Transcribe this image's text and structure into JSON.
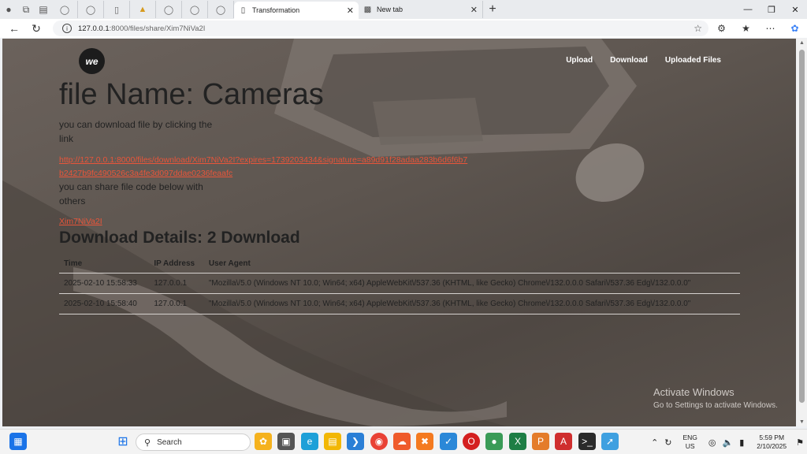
{
  "browser": {
    "tabs": [
      {
        "label": "Transformation",
        "active": true
      },
      {
        "label": "New tab",
        "active": false
      }
    ],
    "url_host": "127.0.0.1",
    "url_path": ":8000/files/share/Xim7NiVa2I"
  },
  "site": {
    "logo_text": "we",
    "nav": [
      "Upload",
      "Download",
      "Uploaded Files"
    ],
    "title": "file Name: Cameras",
    "download_prompt": "you can download file by clicking the link",
    "download_link": "http://127.0.0.1:8000/files/download/Xim7NiVa2I?expires=1739203434&signature=a89d91f28adaa283b6d6f6b7b2427b9fc490526c3a4fe3d097ddae0236feaafc",
    "share_prompt": "you can share file code below with others",
    "file_code": "Xim7NiVa2I",
    "details_heading": "Download Details: 2 Download",
    "table": {
      "headers": [
        "Time",
        "IP Address",
        "User Agent"
      ],
      "rows": [
        [
          "2025-02-10 15:58:33",
          "127.0.0.1",
          "\"Mozilla\\/5.0 (Windows NT 10.0; Win64; x64) AppleWebKit\\/537.36 (KHTML, like Gecko) Chrome\\/132.0.0.0 Safari\\/537.36 Edg\\/132.0.0.0\""
        ],
        [
          "2025-02-10 15:58:40",
          "127.0.0.1",
          "\"Mozilla\\/5.0 (Windows NT 10.0; Win64; x64) AppleWebKit\\/537.36 (KHTML, like Gecko) Chrome\\/132.0.0.0 Safari\\/537.36 Edg\\/132.0.0.0\""
        ]
      ]
    }
  },
  "watermark": {
    "line1": "Activate Windows",
    "line2": "Go to Settings to activate Windows."
  },
  "taskbar": {
    "search_placeholder": "Search",
    "lang_line1": "ENG",
    "lang_line2": "US",
    "time": "5:59 PM",
    "date": "2/10/2025"
  },
  "colors": {
    "link": "#e8553a",
    "page_overlay": "#5e5650"
  }
}
